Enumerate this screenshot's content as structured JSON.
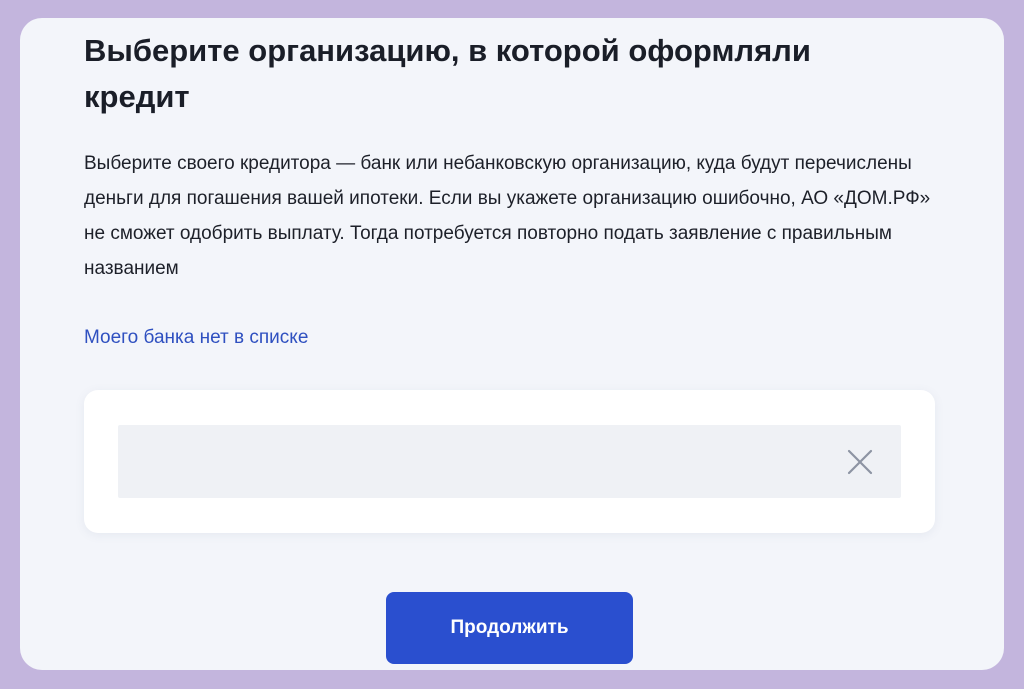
{
  "page": {
    "title": "Выберите организацию, в которой оформляли кредит",
    "description": "Выберите своего кредитора — банк или небанковскую организацию, куда будут перечислены деньги для погашения вашей ипотеки. Если вы укажете организацию ошибочно, АО «ДОМ.РФ» не сможет одобрить выплату. Тогда потребуется повторно подать заявление с правильным названием",
    "missing_bank_link": "Моего банка нет в списке"
  },
  "search": {
    "value": "",
    "placeholder": "",
    "clear_icon": "close-icon"
  },
  "actions": {
    "continue_label": "Продолжить"
  },
  "colors": {
    "outer_border": "#c3b5dd",
    "page_background": "#f3f5fa",
    "link": "#2f50c0",
    "primary_button": "#2a4fcf",
    "field_background": "#eff1f5"
  }
}
